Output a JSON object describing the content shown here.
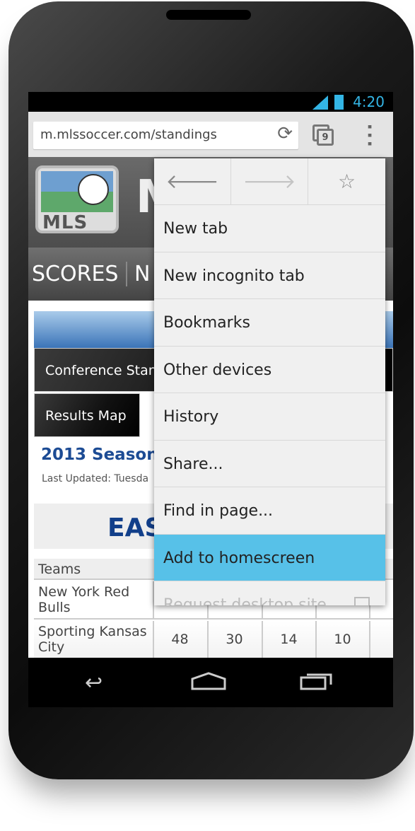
{
  "status_bar": {
    "time": "4:20",
    "accent": "#33b5e5",
    "icons": [
      "signal-icon",
      "battery-icon"
    ]
  },
  "browser": {
    "url": "m.mlssoccer.com/standings",
    "tab_count": "9"
  },
  "site": {
    "logo_text": "MLS",
    "title_partial": "M",
    "nav": [
      "SCORES",
      "N"
    ]
  },
  "content": {
    "buttons": [
      "Conference Stan",
      "Results Map"
    ],
    "season": "2013 Season",
    "updated": "Last Updated: Tuesda",
    "conference_partial": "EAS",
    "table": {
      "header": "Teams",
      "rows": [
        {
          "team": "New York Red Bulls",
          "values": []
        },
        {
          "team": "Sporting Kansas City",
          "values": [
            "48",
            "30",
            "14",
            "10"
          ]
        }
      ]
    }
  },
  "menu": {
    "icons": [
      "back-arrow-icon",
      "forward-arrow-icon",
      "star-icon"
    ],
    "items": [
      "New tab",
      "New incognito tab",
      "Bookmarks",
      "Other devices",
      "History",
      "Share...",
      "Find in page...",
      "Add to homescreen",
      "Request desktop site"
    ],
    "highlighted": "Add to homescreen",
    "highlight_color": "#57c1e8"
  }
}
